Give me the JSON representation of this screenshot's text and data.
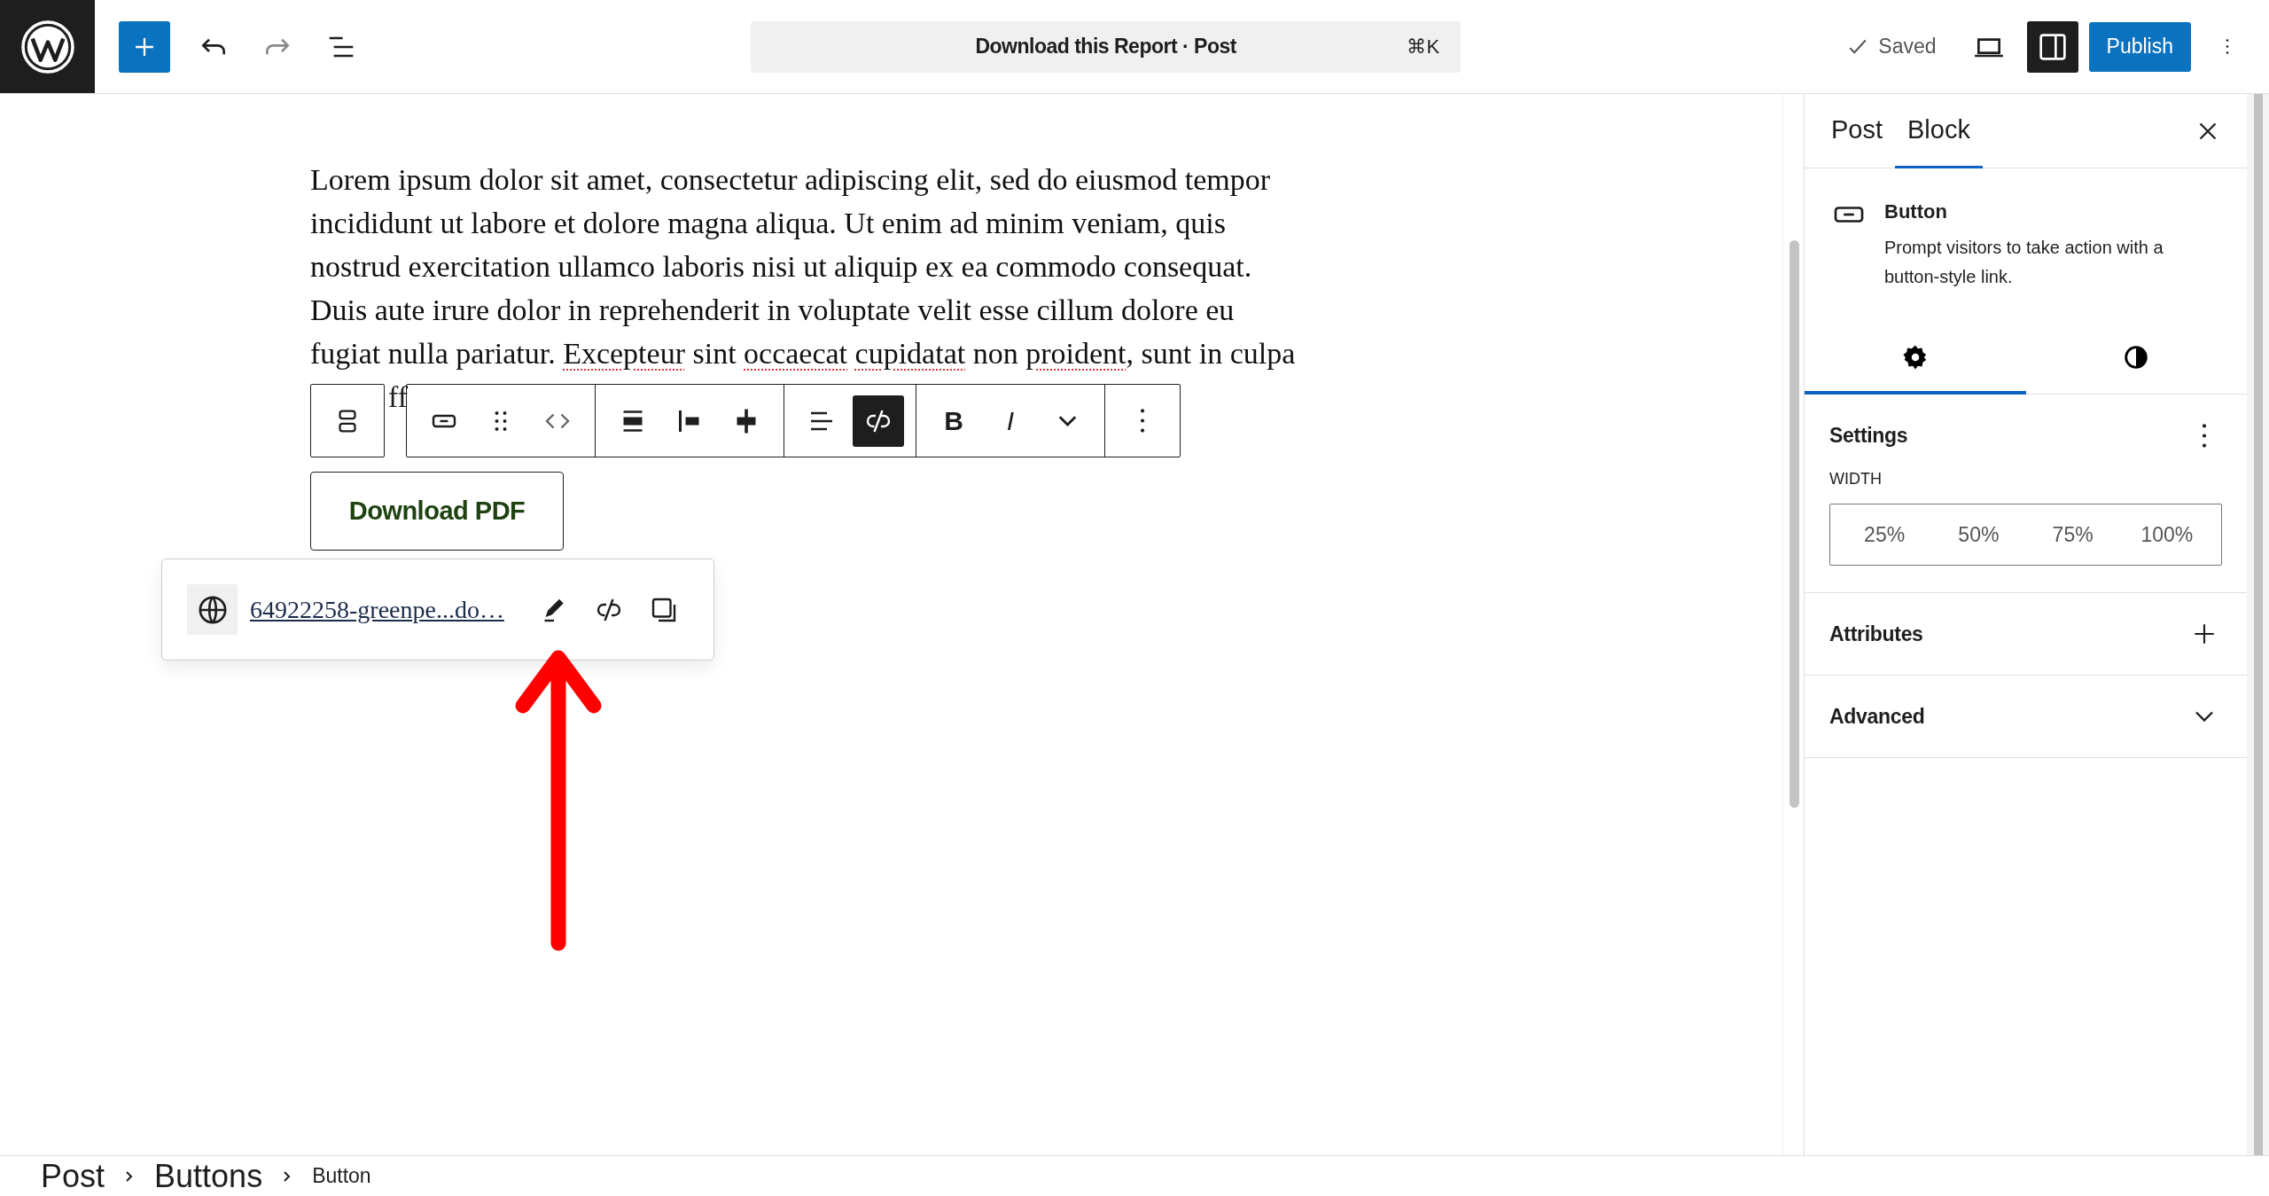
{
  "top_bar": {
    "document_title": "Download this Report · Post",
    "shortcut": "⌘K",
    "save_status": "Saved",
    "settings_toggle_pressed": true,
    "publish_button": "Publish"
  },
  "paragraph": {
    "lines": [
      [
        {
          "text": "Lorem ipsum dolor sit amet, consectetur adipiscing elit, sed do eiusmod tempor",
          "misspelled": false
        }
      ],
      [
        {
          "text": "incididunt ut labore et dolore magna aliqua. Ut enim ad minim veniam, quis",
          "misspelled": false
        }
      ],
      [
        {
          "text": "nostrud exercitation ullamco laboris nisi ut aliquip ex ea commodo consequat.",
          "misspelled": false
        }
      ],
      [
        {
          "text": "Duis aute irure dolor in reprehenderit in voluptate velit esse cillum dolore eu",
          "misspelled": false
        }
      ],
      [
        {
          "text": "fugiat nulla pariatur. ",
          "misspelled": false
        },
        {
          "text": "Excepteur",
          "misspelled": true
        },
        {
          "text": " sint ",
          "misspelled": false
        },
        {
          "text": "occaecat",
          "misspelled": true,
          "gap_after": true
        },
        {
          "text": "cupidatat",
          "misspelled": true
        },
        {
          "text": " non ",
          "misspelled": false
        },
        {
          "text": "proident",
          "misspelled": true
        },
        {
          "text": ", sunt in culpa",
          "misspelled": false
        }
      ]
    ],
    "hidden_tail": "ff"
  },
  "block_toolbar": {
    "parent": {
      "pressed": false
    },
    "groups": [
      [
        {
          "kind": "icon",
          "pressed": false
        },
        {
          "kind": "icon",
          "pressed": false
        },
        {
          "kind": "icon",
          "pressed": false
        }
      ],
      [
        {
          "kind": "icon",
          "pressed": false
        },
        {
          "kind": "icon",
          "pressed": false
        },
        {
          "kind": "icon",
          "pressed": false
        }
      ],
      [
        {
          "kind": "icon",
          "pressed": false
        },
        {
          "kind": "icon",
          "pressed": true
        }
      ],
      [
        {
          "kind": "bold",
          "label": "B",
          "pressed": false
        },
        {
          "kind": "italic",
          "label": "I",
          "pressed": false
        },
        {
          "kind": "icon",
          "pressed": false
        }
      ],
      [
        {
          "kind": "icon",
          "pressed": false
        }
      ]
    ]
  },
  "button_block": {
    "label": "Download PDF"
  },
  "link_popover": {
    "url": "64922258-greenpe...do…"
  },
  "sidebar": {
    "tabs": [
      {
        "label": "Post",
        "selected": false
      },
      {
        "label": "Block",
        "selected": true
      }
    ],
    "block_card": {
      "title": "Button",
      "description": "Prompt visitors to take action with a button-style link."
    },
    "inspector_tabs": [
      {
        "selected": true
      },
      {
        "selected": false
      }
    ],
    "panels": [
      {
        "kind": "settings",
        "title": "Settings",
        "field_label": "WIDTH",
        "options": [
          {
            "label": "25%",
            "selected": false
          },
          {
            "label": "50%",
            "selected": false
          },
          {
            "label": "75%",
            "selected": false
          },
          {
            "label": "100%",
            "selected": false
          }
        ]
      },
      {
        "kind": "add",
        "title": "Attributes"
      },
      {
        "kind": "toggle",
        "title": "Advanced"
      }
    ]
  },
  "breadcrumb": [
    {
      "label": "Post",
      "current": false
    },
    {
      "label": "Buttons",
      "current": false
    },
    {
      "label": "Button",
      "current": true
    }
  ]
}
